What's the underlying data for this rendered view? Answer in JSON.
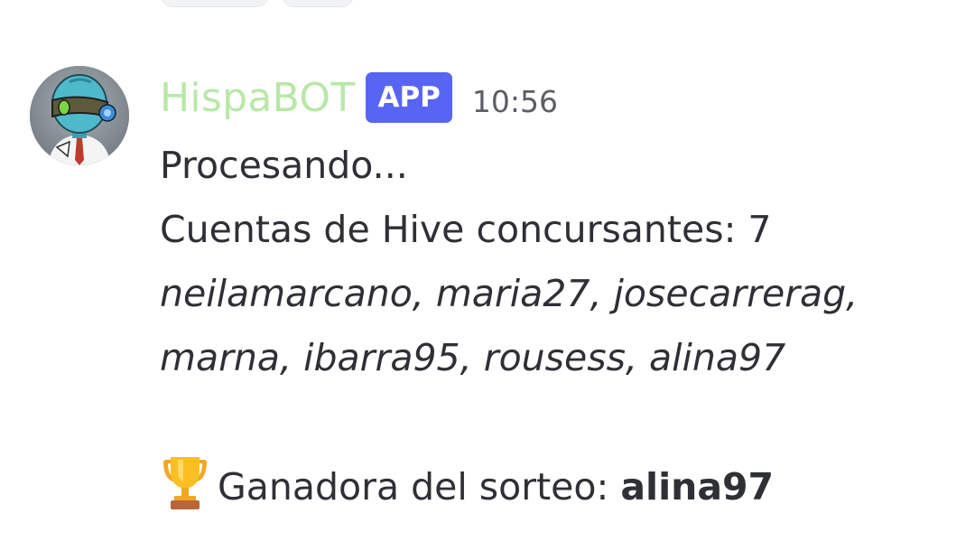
{
  "message": {
    "author": "HispaBOT",
    "badge": "APP",
    "time": "10:56",
    "status_line": "Procesando...",
    "accounts_heading": "Cuentas de Hive concursantes: 7",
    "accounts_list": "neilamarcano, maria27, josecarrerag, marna, ibarra95, rousess, alina97",
    "winner_label": "Ganadora del sorteo:",
    "winner_name": "alina97"
  },
  "colors": {
    "username": "#b8e8a8",
    "badge_bg": "#5865f2",
    "text": "#2e3035",
    "timestamp": "#5c5e66"
  },
  "icons": {
    "winner_icon": "trophy-icon",
    "avatar": "robot-avatar"
  }
}
